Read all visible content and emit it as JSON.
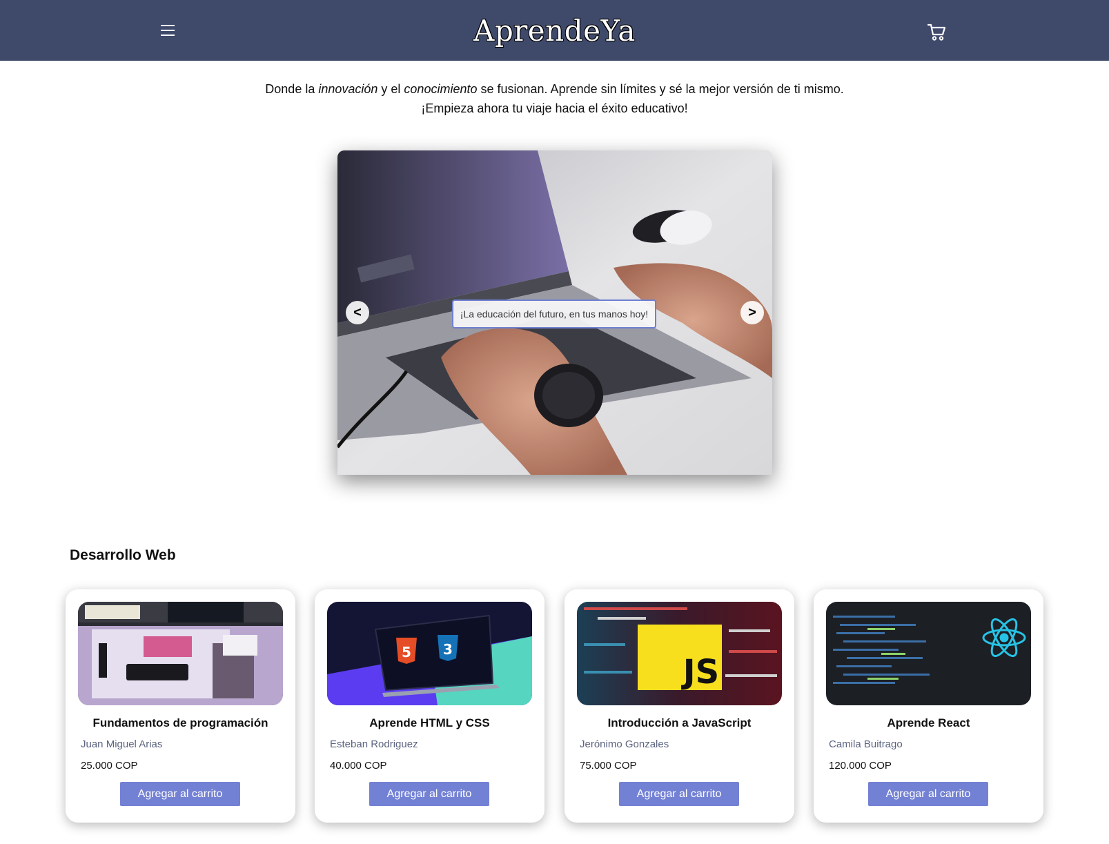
{
  "header": {
    "brand": "AprendeYa",
    "menu_icon": "hamburger-menu-icon",
    "cart_icon": "shopping-cart-icon",
    "bg_color": "#3f4a6b"
  },
  "intro": {
    "line1_before": "Donde la ",
    "line1_em1": "innovación",
    "line1_mid": " y el ",
    "line1_em2": "conocimiento",
    "line1_after": " se fusionan. Aprende sin límites y sé la mejor versión de ti mismo.",
    "line2": "¡Empieza ahora tu viaje hacia el éxito educativo!"
  },
  "carousel": {
    "caption": "¡La educación del futuro, en tus manos hoy!",
    "prev_label": "<",
    "next_label": ">"
  },
  "section": {
    "title": "Desarrollo Web"
  },
  "courses": [
    {
      "title": "Fundamentos de programación",
      "author": "Juan Miguel Arias",
      "price": "25.000 COP",
      "button": "Agregar al carrito"
    },
    {
      "title": "Aprende HTML y CSS",
      "author": "Esteban Rodriguez",
      "price": "40.000 COP",
      "button": "Agregar al carrito"
    },
    {
      "title": "Introducción a JavaScript",
      "author": "Jerónimo Gonzales",
      "price": "75.000 COP",
      "button": "Agregar al carrito"
    },
    {
      "title": "Aprende React",
      "author": "Camila Buitrago",
      "price": "120.000 COP",
      "button": "Agregar al carrito"
    }
  ],
  "colors": {
    "accent_button": "#7381d4",
    "author_text": "#5b6380"
  }
}
